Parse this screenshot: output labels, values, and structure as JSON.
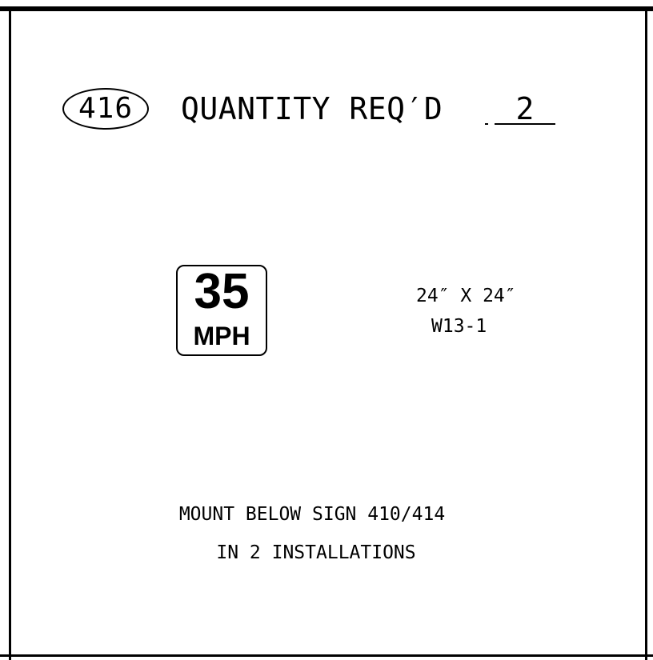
{
  "sign_id": "416",
  "quantity": {
    "label": "QUANTITY REQ′D",
    "value": "2"
  },
  "sign_face": {
    "speed": "35",
    "unit": "MPH"
  },
  "sign_size": "24″ X 24″",
  "sign_code": "W13-1",
  "notes": [
    "MOUNT BELOW SIGN 410/414",
    "IN 2 INSTALLATIONS"
  ]
}
